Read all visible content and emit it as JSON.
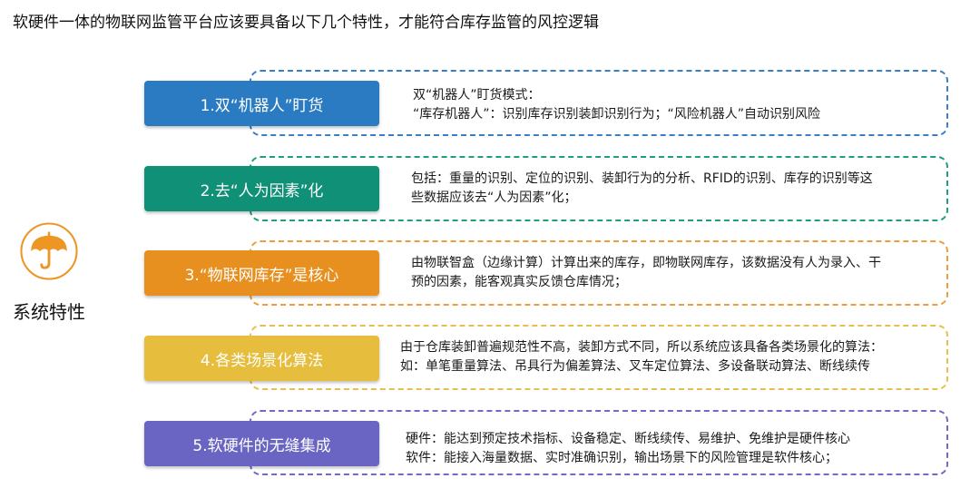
{
  "heading": "软硬件一体的物联网监管平台应该要具备以下几个特性，才能符合库存监管的风控逻辑",
  "left_panel": {
    "icon": "umbrella-icon",
    "label": "系统特性"
  },
  "features": [
    {
      "tag": "1.双“机器人”盯货",
      "color": "#2b7bc3",
      "lines": [
        "双“机器人”盯货模式：",
        "“库存机器人”：识别库存识别装卸识别行为；“风险机器人”自动识别风险"
      ]
    },
    {
      "tag": "2.去“人为因素”化",
      "color": "#109077",
      "lines": [
        "包括：重量的识别、定位的识别、装卸行为的分析、RFID的识别、库存的识别等这",
        "些数据应该去“人为因素”化；"
      ]
    },
    {
      "tag": "3.“物联网库存”是核心",
      "color": "#e8901f",
      "lines": [
        "由物联智盒（边缘计算）计算出来的库存，即物联网库存，该数据没有人为录入、干",
        "预的因素，能客观真实反馈仓库情况；"
      ]
    },
    {
      "tag": "4.各类场景化算法",
      "color": "#e6bd3c",
      "lines": [
        "由于仓库装卸普遍规范性不高，装卸方式不同，所以系统应该具备各类场景化的算法：",
        "如：单笔重量算法、吊具行为偏差算法、叉车定位算法、多设备联动算法、断线续传"
      ]
    },
    {
      "tag": "5.软硬件的无缝集成",
      "color": "#6a64c2",
      "lines": [
        "硬件：能达到预定技术指标、设备稳定、断线续传、易维护、免维护是硬件核心",
        "软件：能接入海量数据、实时准确识别，输出场景下的风险管理是软件核心；"
      ]
    }
  ],
  "box_border_colors": [
    "#3a7fc6",
    "#1f9d80",
    "#ee9d3b",
    "#e6c04f",
    "#6f6ac5"
  ]
}
